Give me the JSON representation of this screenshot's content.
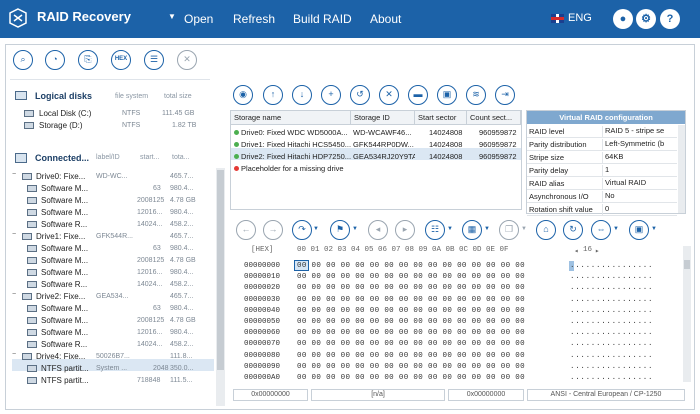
{
  "app": {
    "title": "RAID Recovery"
  },
  "menu": {
    "items": [
      "Open",
      "Refresh",
      "Build RAID",
      "About"
    ],
    "lang": "ENG"
  },
  "left_toolbar": {
    "hex_label": "HEX"
  },
  "logical": {
    "heading": "Logical disks",
    "col_fs": "file system",
    "col_size": "total size",
    "items": [
      {
        "name": "Local Disk (C:)",
        "fs": "NTFS",
        "size": "111.45 GB"
      },
      {
        "name": "Storage (D:)",
        "fs": "NTFS",
        "size": "1.82 TB"
      }
    ]
  },
  "connected": {
    "heading": "Connected...",
    "col_label": "label/ID",
    "col_start": "start...",
    "col_total": "tota...",
    "rows": [
      {
        "name": "Drive0: Fixe...",
        "label": "WD-WC...",
        "start": "",
        "total": "465.7...",
        "level": 0
      },
      {
        "name": "Software M...",
        "label": "",
        "start": "63",
        "total": "980.4...",
        "level": 1
      },
      {
        "name": "Software M...",
        "label": "",
        "start": "2008125",
        "total": "4.78 GB",
        "level": 1
      },
      {
        "name": "Software M...",
        "label": "",
        "start": "12016...",
        "total": "980.4...",
        "level": 1
      },
      {
        "name": "Software R...",
        "label": "",
        "start": "14024...",
        "total": "458.2...",
        "level": 1
      },
      {
        "name": "Drive1: Fixe...",
        "label": "GFK544R...",
        "start": "",
        "total": "465.7...",
        "level": 0
      },
      {
        "name": "Software M...",
        "label": "",
        "start": "63",
        "total": "980.4...",
        "level": 1
      },
      {
        "name": "Software M...",
        "label": "",
        "start": "2008125",
        "total": "4.78 GB",
        "level": 1
      },
      {
        "name": "Software M...",
        "label": "",
        "start": "12016...",
        "total": "980.4...",
        "level": 1
      },
      {
        "name": "Software R...",
        "label": "",
        "start": "14024...",
        "total": "458.2...",
        "level": 1
      },
      {
        "name": "Drive2: Fixe...",
        "label": "GEA534...",
        "start": "",
        "total": "465.7...",
        "level": 0
      },
      {
        "name": "Software M...",
        "label": "",
        "start": "63",
        "total": "980.4...",
        "level": 1
      },
      {
        "name": "Software M...",
        "label": "",
        "start": "2008125",
        "total": "4.78 GB",
        "level": 1
      },
      {
        "name": "Software M...",
        "label": "",
        "start": "12016...",
        "total": "980.4...",
        "level": 1
      },
      {
        "name": "Software R...",
        "label": "",
        "start": "14024...",
        "total": "458.2...",
        "level": 1
      },
      {
        "name": "Drive4: Fixe...",
        "label": "50026B7...",
        "start": "",
        "total": "111.8...",
        "level": 0
      },
      {
        "name": "NTFS partit...",
        "label": "System ...",
        "start": "2048",
        "total": "350.0...",
        "level": 1
      },
      {
        "name": "NTFS partit...",
        "label": "",
        "start": "718848",
        "total": "111.5...",
        "level": 1
      }
    ]
  },
  "table": {
    "headers": [
      "Storage name",
      "Storage ID",
      "Start sector",
      "Count sect..."
    ],
    "rows": [
      {
        "name": "Drive0: Fixed WDC WD5000A...",
        "id": "WD-WCAWF46...",
        "start": "14024808",
        "count": "960959872",
        "status": "ok"
      },
      {
        "name": "Drive1: Fixed Hitachi HCS5450...",
        "id": "GFK544RP0DW...",
        "start": "14024808",
        "count": "960959872",
        "status": "ok"
      },
      {
        "name": "Drive2: Fixed Hitachi HDP7250...",
        "id": "GEA534RJ20Y9TA",
        "start": "14024808",
        "count": "960959872",
        "status": "ok"
      },
      {
        "name": "Placeholder for a missing drive",
        "id": "",
        "start": "",
        "count": "",
        "status": "missing"
      }
    ]
  },
  "vrc": {
    "title": "Virtual RAID configuration",
    "props": [
      {
        "k": "RAID level",
        "v": "RAID 5 - stripe se"
      },
      {
        "k": "Parity distribution",
        "v": "Left-Symmetric (b"
      },
      {
        "k": "Stripe size",
        "v": "64KB"
      },
      {
        "k": "Parity delay",
        "v": "1"
      },
      {
        "k": "RAID alias",
        "v": "Virtual RAID"
      },
      {
        "k": "Asynchronous I/O",
        "v": "No"
      },
      {
        "k": "Rotation shift value",
        "v": "0"
      }
    ]
  },
  "hex": {
    "corner": "[HEX]",
    "columns": "00 01 02 03 04 05 06 07 08 09 0A 0B 0C 0D 0E 0F",
    "width": "16",
    "offsets": [
      "00000000",
      "00000010",
      "00000020",
      "00000030",
      "00000040",
      "00000050",
      "00000060",
      "00000070",
      "00000080",
      "00000090",
      "000000A0"
    ],
    "bytes": "00 00 00 00 00 00 00 00 00 00 00 00 00 00 00 00",
    "ascii": "................"
  },
  "status": {
    "offset": "0x00000000",
    "na": "[n/a]",
    "value": "0x00000000",
    "encoding": "ANSI - Central European / CP-1250"
  },
  "colors": {
    "accent": "#1c62a8",
    "ok": "#4caf50",
    "missing": "#e53935"
  }
}
